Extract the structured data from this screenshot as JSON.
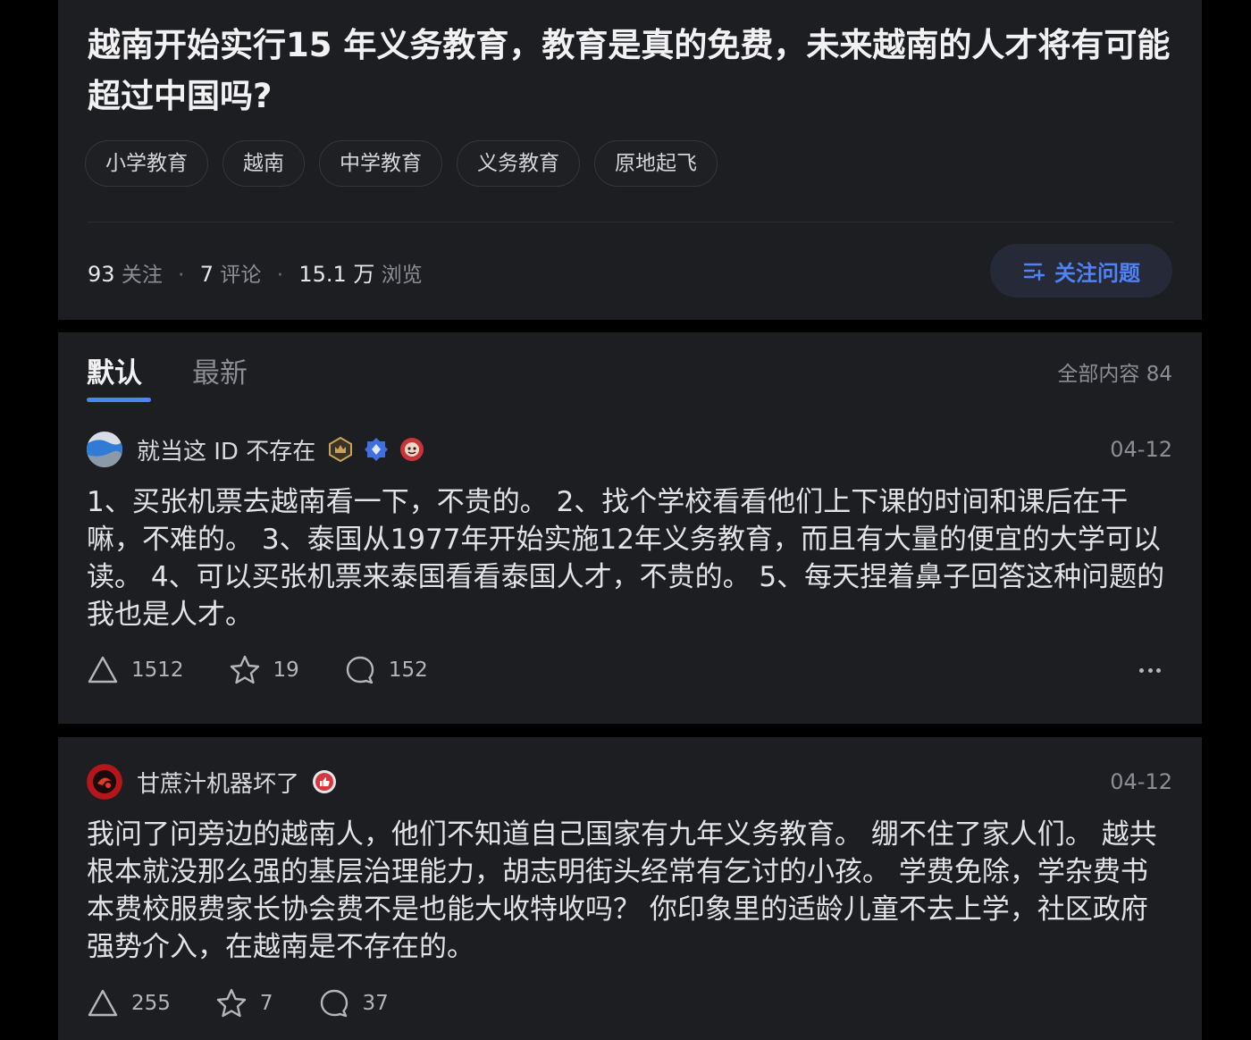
{
  "question": {
    "title": "越南开始实行15 年义务教育，教育是真的免费，未来越南的人才将有可能超过中国吗?",
    "tags": [
      "小学教育",
      "越南",
      "中学教育",
      "义务教育",
      "原地起飞"
    ],
    "stats": {
      "followers_num": "93",
      "followers_label": "关注",
      "comments_num": "7",
      "comments_label": "评论",
      "views_num": "15.1 万",
      "views_label": "浏览",
      "separator": "·"
    },
    "follow_button_label": "关注问题"
  },
  "answers_header": {
    "tabs": [
      "默认",
      "最新"
    ],
    "total_label": "全部内容 84"
  },
  "answers": [
    {
      "author": "就当这 ID 不存在",
      "date": "04-12",
      "content": "1、买张机票去越南看一下，不贵的。 2、找个学校看看他们上下课的时间和课后在干嘛，不难的。 3、泰国从1977年开始实施12年义务教育，而且有大量的便宜的大学可以读。 4、可以买张机票来泰国看看泰国人才，不贵的。 5、每天捏着鼻子回答这种问题的我也是人才。",
      "upvotes": "1512",
      "favorites": "19",
      "comments": "152"
    },
    {
      "author": "甘蔗汁机器坏了",
      "date": "04-12",
      "content": "我问了问旁边的越南人，他们不知道自己国家有九年义务教育。 绷不住了家人们。 越共根本就没那么强的基层治理能力，胡志明街头经常有乞讨的小孩。 学费免除，学杂费书本费校服费家长协会费不是也能大收特收吗？ 你印象里的适龄儿童不去上学，社区政府强势介入，在越南是不存在的。",
      "upvotes": "255",
      "favorites": "7",
      "comments": "37"
    }
  ],
  "colors": {
    "background": "#000000",
    "card": "#1d1e22",
    "accent_blue": "#4f82f5",
    "muted_text": "#8c8e95"
  },
  "icons": [
    "follow-list-plus-icon",
    "upvote-icon",
    "star-icon",
    "comment-icon",
    "more-icon",
    "badge-crown-icon",
    "badge-diamond-icon",
    "badge-monkey-icon",
    "badge-thumb-icon"
  ]
}
